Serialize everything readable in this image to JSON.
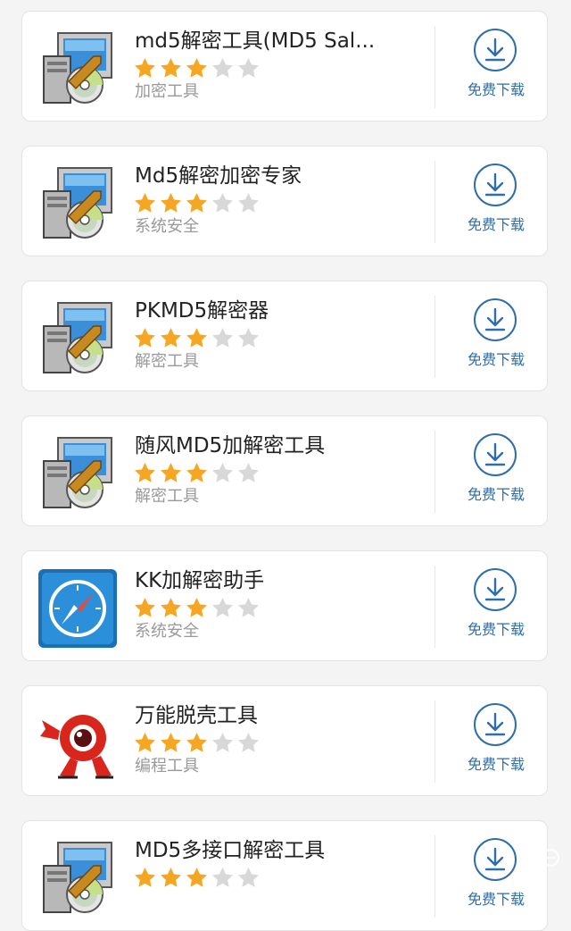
{
  "apps": [
    {
      "title": "md5解密工具(MD5 Sal...",
      "category": "加密工具",
      "rating": 3,
      "max_rating": 5,
      "icon": "installer-icon",
      "download_label": "免费下载"
    },
    {
      "title": "Md5解密加密专家",
      "category": "系统安全",
      "rating": 3,
      "max_rating": 5,
      "icon": "installer-icon",
      "download_label": "免费下载"
    },
    {
      "title": "PKMD5解密器",
      "category": "解密工具",
      "rating": 3,
      "max_rating": 5,
      "icon": "installer-icon",
      "download_label": "免费下载"
    },
    {
      "title": "随风MD5加解密工具",
      "category": "解密工具",
      "rating": 3,
      "max_rating": 5,
      "icon": "installer-icon",
      "download_label": "免费下载"
    },
    {
      "title": "KK加解密助手",
      "category": "系统安全",
      "rating": 3,
      "max_rating": 5,
      "icon": "compass-icon",
      "download_label": "免费下载"
    },
    {
      "title": "万能脱壳工具",
      "category": "编程工具",
      "rating": 3,
      "max_rating": 5,
      "icon": "mascot-icon",
      "download_label": "免费下载"
    },
    {
      "title": "MD5多接口解密工具",
      "category": "",
      "rating": 3,
      "max_rating": 5,
      "icon": "installer-icon",
      "download_label": "免费下载"
    }
  ],
  "colors": {
    "star_filled": "#f5a623",
    "star_empty": "#d8d8d8",
    "download_accent": "#2f6ea8"
  }
}
